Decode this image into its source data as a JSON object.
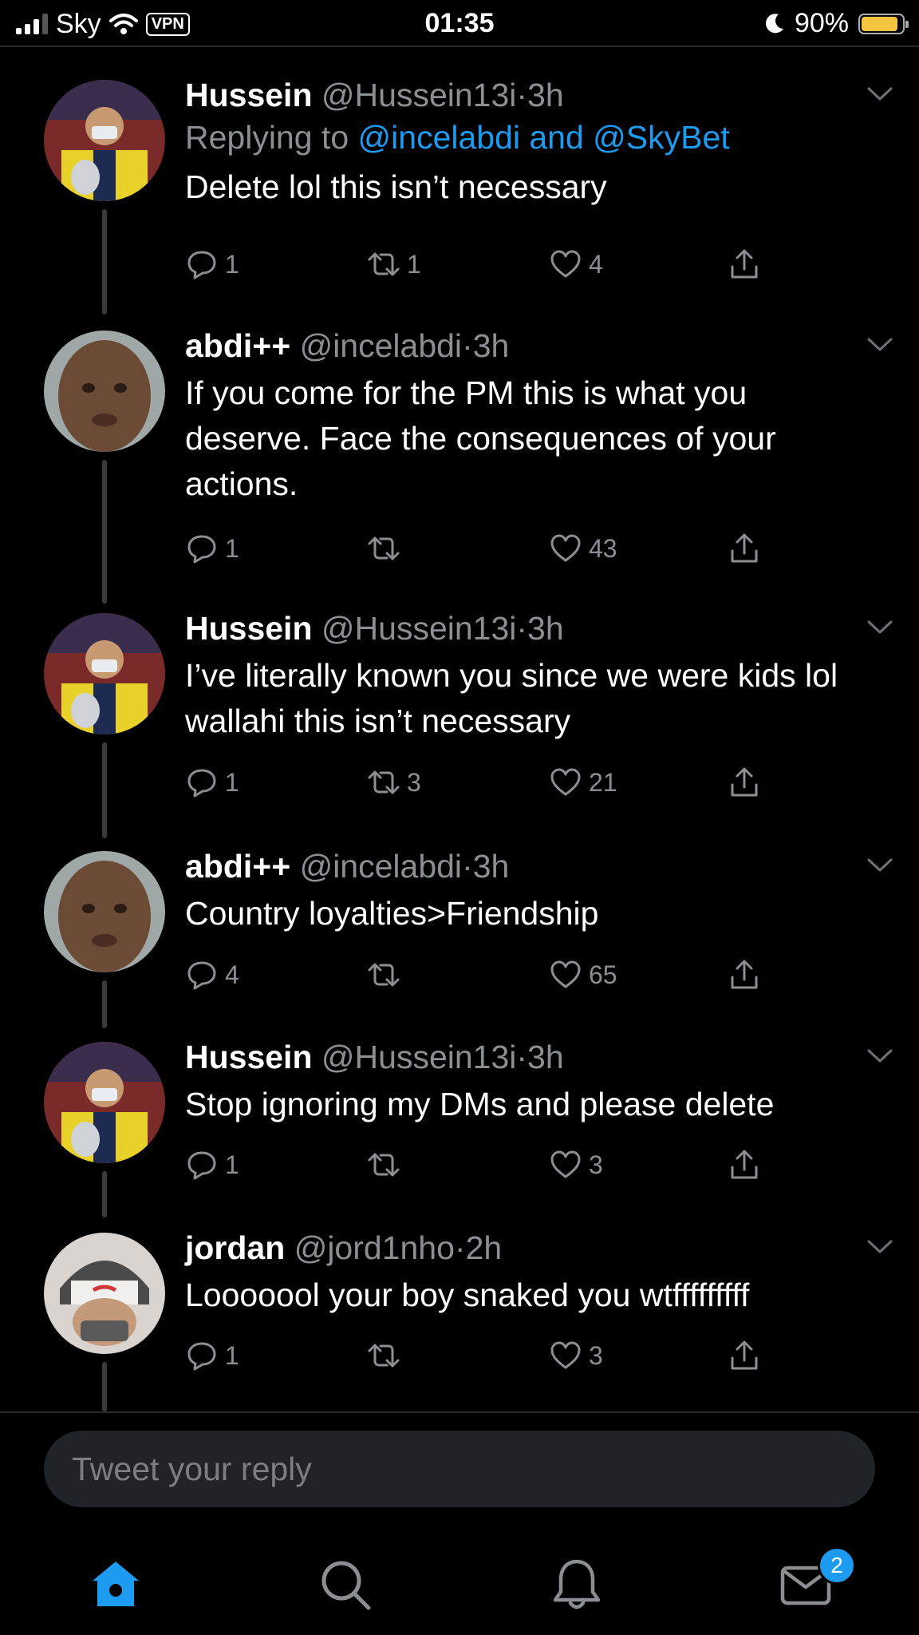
{
  "status_bar": {
    "carrier": "Sky",
    "vpn": "VPN",
    "time": "01:35",
    "battery": "90%",
    "battery_level": 0.9
  },
  "tweets": [
    {
      "name": "Hussein",
      "handle": "@Hussein13i",
      "sep": "·",
      "time": "3h",
      "reply_prefix": "Replying to",
      "reply_targets": "@incelabdi and @SkyBet",
      "text": "Delete lol this isn’t necessary",
      "replies": "1",
      "retweets": "1",
      "likes": "4"
    },
    {
      "name": "abdi++",
      "handle": "@incelabdi",
      "sep": "·",
      "time": "3h",
      "text": "If you come for the PM this is what you deserve. Face the consequences of your actions.",
      "replies": "1",
      "retweets": "",
      "likes": "43"
    },
    {
      "name": "Hussein",
      "handle": "@Hussein13i",
      "sep": "·",
      "time": "3h",
      "text": "I’ve literally known you since we were kids lol wallahi this isn’t necessary",
      "replies": "1",
      "retweets": "3",
      "likes": "21"
    },
    {
      "name": "abdi++",
      "handle": "@incelabdi",
      "sep": "·",
      "time": "3h",
      "text": "Country loyalties>Friendship",
      "replies": "4",
      "retweets": "",
      "likes": "65"
    },
    {
      "name": "Hussein",
      "handle": "@Hussein13i",
      "sep": "·",
      "time": "3h",
      "text": "Stop ignoring my DMs and please delete",
      "replies": "1",
      "retweets": "",
      "likes": "3"
    },
    {
      "name": "jordan",
      "handle": "@jord1nho",
      "sep": "·",
      "time": "2h",
      "text": "Looooool your boy snaked you wtfffffffff",
      "replies": "1",
      "retweets": "",
      "likes": "3"
    }
  ],
  "composer": {
    "placeholder": "Tweet your reply"
  },
  "tabbar": {
    "icons": [
      "home-icon",
      "search-icon",
      "bell-icon",
      "mail-icon"
    ],
    "messages_badge": "2"
  },
  "colors": {
    "background": "#000000",
    "link": "#1d9bf0",
    "muted": "#8b8f94",
    "battery": "#f5c542"
  }
}
